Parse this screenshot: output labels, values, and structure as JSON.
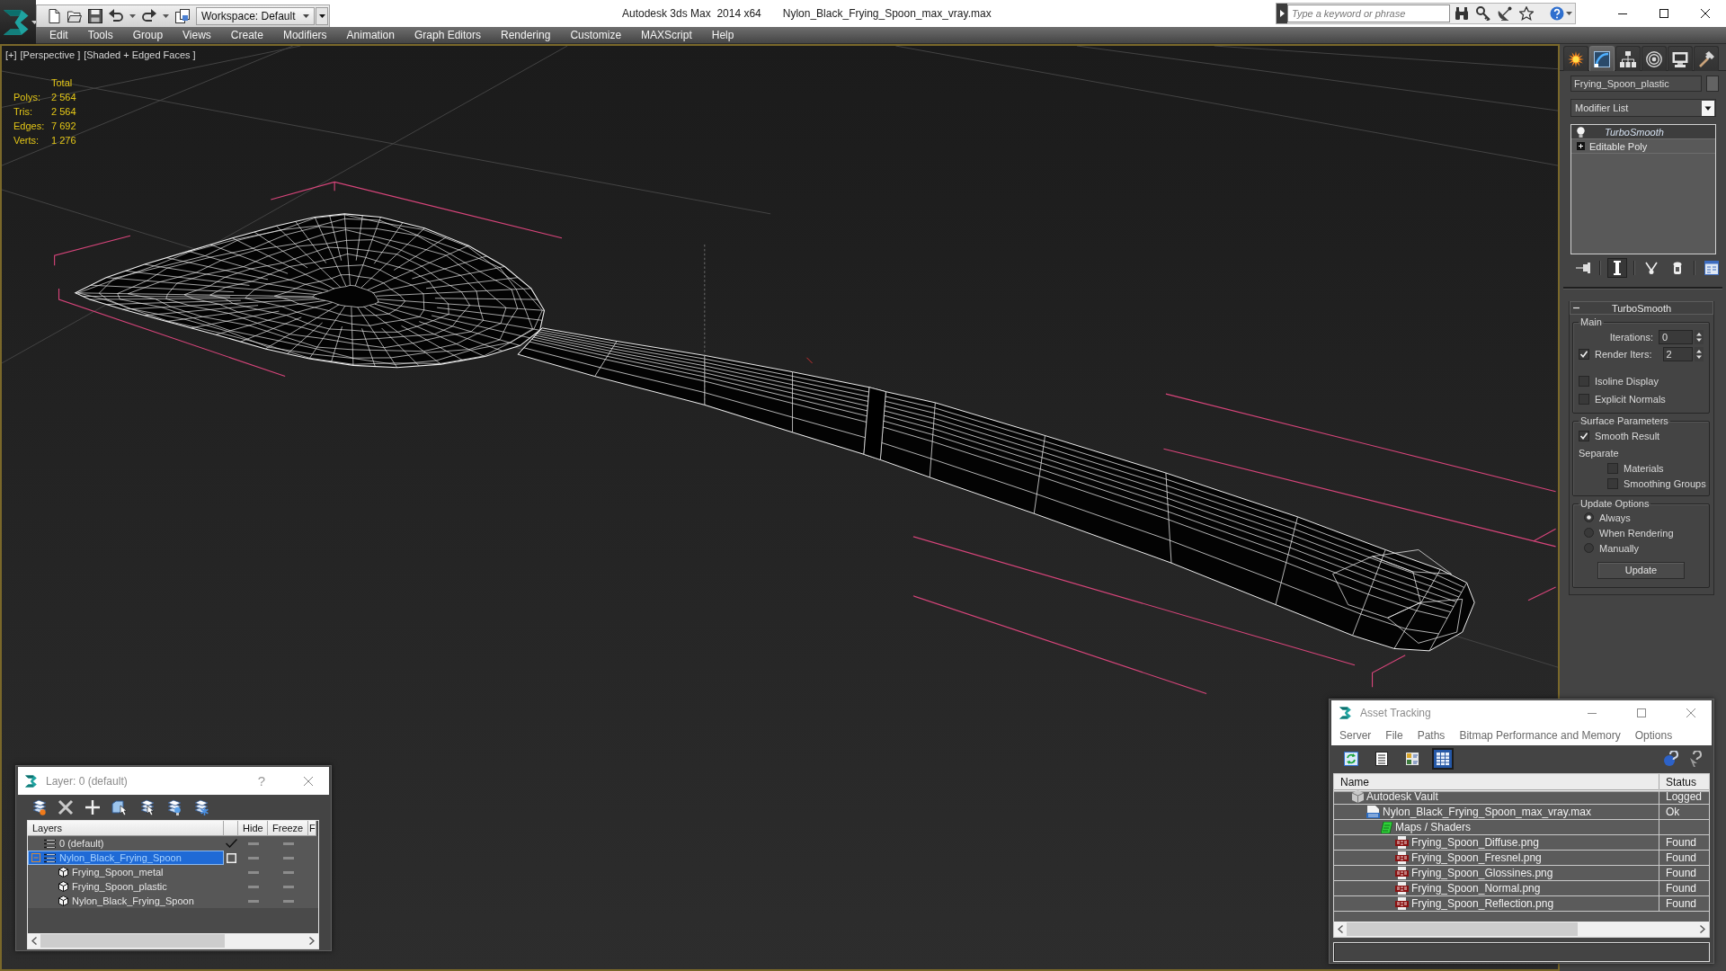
{
  "title_bar": {
    "workspace": "Workspace: Default",
    "app_title": "Autodesk 3ds Max  2014 x64",
    "file_name": "Nylon_Black_Frying_Spoon_max_vray.max",
    "search": {
      "placeholder": "Type a keyword or phrase"
    }
  },
  "menu": [
    "Edit",
    "Tools",
    "Group",
    "Views",
    "Create",
    "Modifiers",
    "Animation",
    "Graph Editors",
    "Rendering",
    "Customize",
    "MAXScript",
    "Help"
  ],
  "viewport": {
    "labels": [
      "[+]",
      "[Perspective ]",
      "[Shaded + Edged Faces ]"
    ],
    "stats": {
      "heading": "Total",
      "rows": [
        {
          "label": "Polys:",
          "value": "2 564"
        },
        {
          "label": "Tris:",
          "value": "2 564"
        },
        {
          "label": "Edges:",
          "value": "7 692"
        },
        {
          "label": "Verts:",
          "value": "1 276"
        }
      ]
    }
  },
  "command_panel": {
    "tabs": [
      {
        "kind": "create",
        "selected": false
      },
      {
        "kind": "modify",
        "selected": true
      },
      {
        "kind": "hierarchy",
        "selected": false
      },
      {
        "kind": "motion",
        "selected": false
      },
      {
        "kind": "display",
        "selected": false
      },
      {
        "kind": "utilities",
        "selected": false
      }
    ],
    "object_name": "Frying_Spoon_plastic",
    "modifier_list": "Modifier List",
    "stack": [
      {
        "label": "TurboSmooth",
        "kind": "modifier",
        "enabled": true,
        "selected": true
      },
      {
        "label": "Editable Poly",
        "kind": "object",
        "expanded": false,
        "selected": false
      }
    ],
    "stack_buttons": [
      {
        "kind": "pin",
        "selected": false
      },
      {
        "kind": "end_result",
        "selected": true
      },
      {
        "kind": "make_unique",
        "selected": false
      },
      {
        "kind": "remove",
        "selected": false
      },
      {
        "kind": "configure",
        "selected": false
      }
    ],
    "rollout": {
      "title": "TurboSmooth",
      "expanded": true,
      "groups": [
        {
          "title": "Main",
          "controls": [
            {
              "kind": "spinner",
              "label": "Iterations:",
              "value": "0"
            },
            {
              "kind": "checkspinner",
              "label": "Render Iters:",
              "value": "2",
              "checked": true
            },
            {
              "kind": "checkbox",
              "label": "Isoline Display",
              "checked": false
            },
            {
              "kind": "checkbox",
              "label": "Explicit Normals",
              "checked": false
            }
          ]
        },
        {
          "title": "Surface Parameters",
          "controls": [
            {
              "kind": "checkbox",
              "label": "Smooth Result",
              "checked": true
            },
            {
              "kind": "caption",
              "label": "Separate"
            },
            {
              "kind": "subcheckbox",
              "label": "Materials",
              "checked": false
            },
            {
              "kind": "subcheckbox",
              "label": "Smoothing Groups",
              "checked": false
            }
          ]
        },
        {
          "title": "Update Options",
          "controls": [
            {
              "kind": "radio",
              "label": "Always",
              "selected": true
            },
            {
              "kind": "radio",
              "label": "When Rendering",
              "selected": false
            },
            {
              "kind": "radio",
              "label": "Manually",
              "selected": false
            },
            {
              "kind": "button",
              "label": "Update"
            }
          ]
        }
      ]
    }
  },
  "layer_dialog": {
    "title": "Layer: 0 (default)",
    "help": "?",
    "columns": [
      "Layers",
      "Hide",
      "Freeze",
      "F"
    ],
    "layers": [
      {
        "name": "0 (default)",
        "kind": "layer",
        "current": true,
        "selected": false,
        "hidden": false,
        "frozen": false
      },
      {
        "name": "Nylon_Black_Frying_Spoon",
        "kind": "layer",
        "current": false,
        "selected": true,
        "expanded": true,
        "hidden": false,
        "frozen": false,
        "children": [
          {
            "name": "Frying_Spoon_metal",
            "kind": "object",
            "selected": false,
            "hidden": false,
            "frozen": false
          },
          {
            "name": "Frying_Spoon_plastic",
            "kind": "object",
            "selected": false,
            "hidden": false,
            "frozen": false
          },
          {
            "name": "Nylon_Black_Frying_Spoon",
            "kind": "object",
            "selected": false,
            "hidden": false,
            "frozen": false
          }
        ]
      }
    ]
  },
  "asset_tracking": {
    "title": "Asset Tracking",
    "menu": [
      "Server",
      "File",
      "Paths",
      "Bitmap Performance and Memory",
      "Options"
    ],
    "view_buttons": [
      {
        "kind": "refresh",
        "selected": false
      },
      {
        "kind": "list",
        "selected": false
      },
      {
        "kind": "thumbnails",
        "selected": false
      },
      {
        "kind": "table",
        "selected": true
      }
    ],
    "columns": [
      "Name",
      "Status"
    ],
    "assets": [
      {
        "name": "Autodesk Vault",
        "kind": "vault",
        "status": "Logged",
        "children": [
          {
            "name": "Nylon_Black_Frying_Spoon_max_vray.max",
            "kind": "scene",
            "status": "Ok",
            "children": [
              {
                "name": "Maps / Shaders",
                "kind": "folder",
                "children": [
                  {
                    "name": "Frying_Spoon_Diffuse.png",
                    "kind": "image",
                    "status": "Found"
                  },
                  {
                    "name": "Frying_Spoon_Fresnel.png",
                    "kind": "image",
                    "status": "Found"
                  },
                  {
                    "name": "Frying_Spoon_Glossines.png",
                    "kind": "image",
                    "status": "Found"
                  },
                  {
                    "name": "Frying_Spoon_Normal.png",
                    "kind": "image",
                    "status": "Found"
                  },
                  {
                    "name": "Frying_Spoon_Reflection.png",
                    "kind": "image",
                    "status": "Found"
                  }
                ]
              }
            ]
          }
        ]
      }
    ]
  }
}
